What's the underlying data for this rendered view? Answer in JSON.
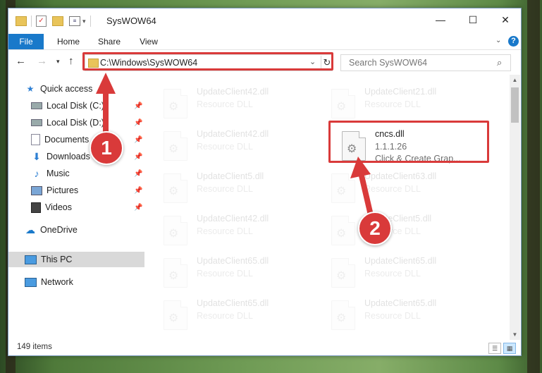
{
  "window": {
    "title": "SysWOW64",
    "controls": {
      "minimize": "—",
      "maximize": "☐",
      "close": "✕"
    }
  },
  "ribbon": {
    "tabs": [
      "File",
      "Home",
      "Share",
      "View"
    ],
    "help": "?"
  },
  "address": {
    "path": "C:\\Windows\\SysWOW64",
    "search_placeholder": "Search SysWOW64"
  },
  "sidebar": {
    "quick_access": "Quick access",
    "items": [
      {
        "label": "Local Disk (C:)",
        "icon": "drive-icon",
        "pinned": true
      },
      {
        "label": "Local Disk (D:)",
        "icon": "drive-icon",
        "pinned": true
      },
      {
        "label": "Documents",
        "icon": "documents-icon",
        "pinned": true
      },
      {
        "label": "Downloads",
        "icon": "downloads-icon",
        "pinned": true
      },
      {
        "label": "Music",
        "icon": "music-icon",
        "pinned": true
      },
      {
        "label": "Pictures",
        "icon": "pictures-icon",
        "pinned": true
      },
      {
        "label": "Videos",
        "icon": "videos-icon",
        "pinned": true
      }
    ],
    "onedrive": "OneDrive",
    "this_pc": "This PC",
    "network": "Network"
  },
  "files": {
    "col1": [
      {
        "name": "UpdateClient42.dll",
        "type": "Resource DLL"
      },
      {
        "name": "UpdateClient42.dll",
        "type": "Resource DLL"
      },
      {
        "name": "UpdateClient5.dll",
        "type": "Resource DLL"
      },
      {
        "name": "UpdateClient42.dll",
        "type": "Resource DLL"
      },
      {
        "name": "UpdateClient65.dll",
        "type": "Resource DLL"
      },
      {
        "name": "UpdateClient65.dll",
        "type": "Resource DLL"
      }
    ],
    "col2": [
      {
        "name": "UpdateClient21.dll",
        "type": "Resource DLL"
      },
      {
        "name": "UpdateClient63.dll",
        "type": "Resource DLL"
      },
      {
        "name": "UpdateClient5.dll",
        "type": "Resource DLL"
      },
      {
        "name": "UpdateClient65.dll",
        "type": "Resource DLL"
      },
      {
        "name": "UpdateClient65.dll",
        "type": "Resource DLL"
      }
    ],
    "highlighted": {
      "name": "cncs.dll",
      "version": "1.1.1.26",
      "description": "Click & Create Grap..."
    }
  },
  "status": {
    "item_count": "149 items"
  },
  "annotations": {
    "step1": "1",
    "step2": "2",
    "color": "#d93a3a"
  }
}
